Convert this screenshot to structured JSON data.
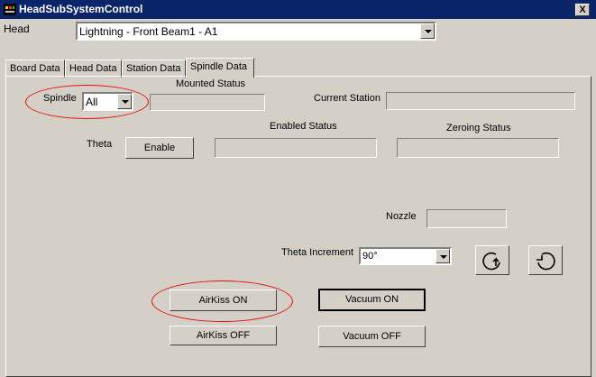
{
  "window": {
    "title": "HeadSubSystemControl",
    "close_glyph": "X",
    "icon": "app-icon"
  },
  "head": {
    "label": "Head",
    "value": "Lightning  -  Front Beam1  -  A1"
  },
  "tabs": [
    {
      "label": "Board Data"
    },
    {
      "label": "Head Data"
    },
    {
      "label": "Station Data"
    },
    {
      "label": "Spindle Data",
      "active": true
    }
  ],
  "spindle": {
    "label": "Spindle",
    "value": "All",
    "mounted_status_label": "Mounted Status",
    "mounted_status_value": "",
    "current_station_label": "Current Station",
    "current_station_value": ""
  },
  "theta": {
    "label": "Theta",
    "enable_label": "Enable",
    "enabled_status_label": "Enabled Status",
    "enabled_status_value": "",
    "zeroing_status_label": "Zeroing Status",
    "zeroing_status_value": ""
  },
  "nozzle": {
    "label": "Nozzle",
    "value": ""
  },
  "theta_increment": {
    "label": "Theta Increment",
    "value": "90°"
  },
  "rotate_buttons": {
    "cw_icon": "rotate-cw-icon",
    "ccw_icon": "rotate-ccw-icon"
  },
  "airkiss": {
    "on_label": "AirKiss ON",
    "off_label": "AirKiss OFF"
  },
  "vacuum": {
    "on_label": "Vacuum ON",
    "off_label": "Vacuum OFF"
  },
  "colors": {
    "titlebar": "#0a246a",
    "face": "#d4d0c8",
    "annotation": "#e01010"
  }
}
